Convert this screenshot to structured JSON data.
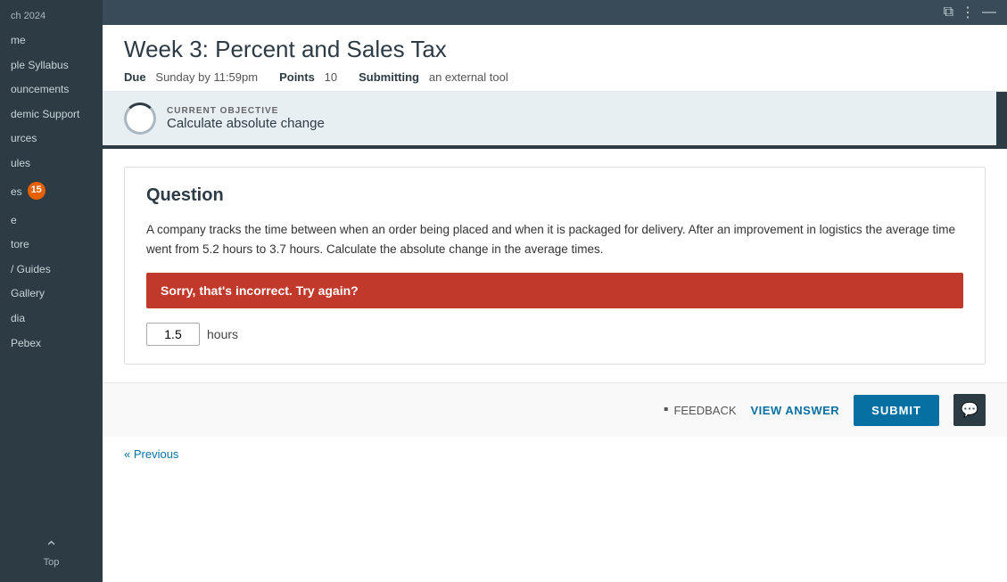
{
  "sidebar": {
    "year": "ch 2024",
    "items": [
      {
        "id": "me",
        "label": "me",
        "badge": null
      },
      {
        "id": "syllabus",
        "label": "ple Syllabus",
        "badge": null
      },
      {
        "id": "announcements",
        "label": "ouncements",
        "badge": null
      },
      {
        "id": "academic-support",
        "label": "demic Support",
        "badge": null
      },
      {
        "id": "resources",
        "label": "urces",
        "badge": null
      },
      {
        "id": "modules",
        "label": "ules",
        "badge": null
      },
      {
        "id": "es",
        "label": "es",
        "badge": "15"
      },
      {
        "id": "e",
        "label": "e",
        "badge": null
      },
      {
        "id": "store",
        "label": "tore",
        "badge": null
      },
      {
        "id": "guides",
        "label": "/ Guides",
        "badge": null
      },
      {
        "id": "gallery",
        "label": "Gallery",
        "badge": null
      },
      {
        "id": "media",
        "label": "dia",
        "badge": null
      },
      {
        "id": "webex",
        "label": "Pebex",
        "badge": null
      }
    ],
    "top_label": "Top"
  },
  "topbar": {
    "icons": [
      "⧉",
      "⋮",
      "—"
    ]
  },
  "page": {
    "title": "Week 3: Percent and Sales Tax",
    "due_label": "Due",
    "due_value": "Sunday by 11:59pm",
    "points_label": "Points",
    "points_value": "10",
    "submitting_label": "Submitting",
    "submitting_value": "an external tool"
  },
  "objective": {
    "sublabel": "CURRENT OBJECTIVE",
    "text": "Calculate absolute change"
  },
  "question": {
    "title": "Question",
    "body": "A company tracks the time between when an order being placed and when it is packaged for delivery. After an improvement in logistics the average time went from 5.2 hours to 3.7 hours. Calculate the absolute change in the average times.",
    "error_message": "Sorry, that's incorrect. Try again?",
    "answer_value": "1.5",
    "answer_unit": "hours"
  },
  "actions": {
    "feedback_label": "FEEDBACK",
    "view_answer_label": "VIEW ANSWER",
    "submit_label": "SUBMIT",
    "previous_label": "« Previous"
  },
  "icons": {
    "feedback": "▪",
    "chat": "≡"
  }
}
